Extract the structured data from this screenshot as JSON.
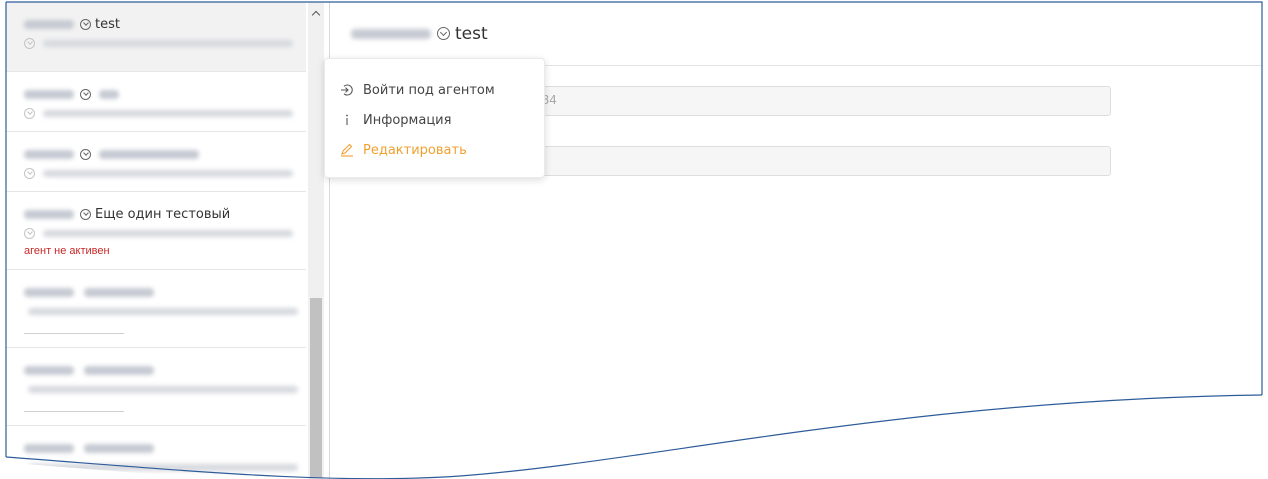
{
  "sidebar": {
    "items": [
      {
        "name": "test",
        "status": ""
      },
      {
        "name": "",
        "status": ""
      },
      {
        "name": "",
        "status": ""
      },
      {
        "name": "Еще один тестовый",
        "status": "агент не активен"
      },
      {
        "name": "",
        "status": ""
      },
      {
        "name": "",
        "status": ""
      },
      {
        "name": "",
        "status": ""
      }
    ]
  },
  "main": {
    "title": "test",
    "field_1_value": "584",
    "field_2_value": ""
  },
  "menu": {
    "login_as_agent": "Войти под агентом",
    "info": "Информация",
    "edit": "Редактировать"
  },
  "icons": {
    "login": "login-icon",
    "info": "info-icon",
    "edit": "pencil-icon",
    "chevron": "circle-chevron-icon"
  },
  "colors": {
    "accent": "#f0a030",
    "inactive_status": "#c62828",
    "frame_line": "#2e5c9a"
  }
}
